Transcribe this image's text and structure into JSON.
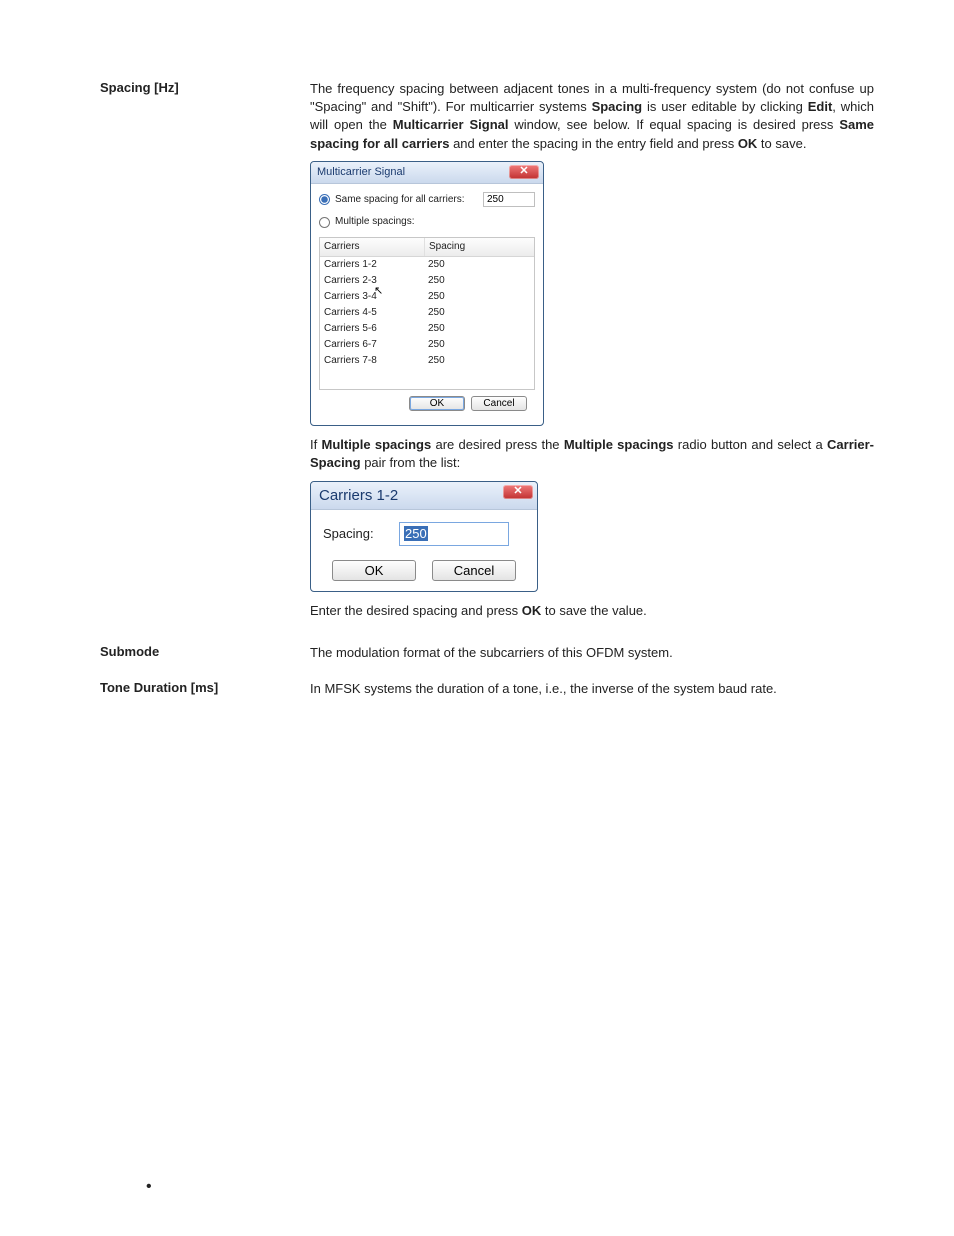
{
  "section1": {
    "label": "Spacing [Hz]",
    "para1_a": "The frequency spacing between adjacent tones in a multi-frequency system (do not confuse up \"Spacing\" and \"Shift\"). For multicarrier systems ",
    "para1_b_bold": "Spacing",
    "para1_c": " is user editable by clicking ",
    "para1_d_bold": "Edit",
    "para1_e": ", which will open the ",
    "para1_f_bold": "Multicarrier Signal",
    "para1_g": " window, see below. If equal spacing is desired press ",
    "para1_h_bold": "Same spacing for all carriers",
    "para1_i": " and enter the spacing in the entry field and press ",
    "para1_j_bold": "OK",
    "para1_k": " to save.",
    "para2_a": "If ",
    "para2_b_bold": "Multiple spacings",
    "para2_c": " are desired press the ",
    "para2_d_bold": "Multiple spacings",
    "para2_e": " radio button and select a ",
    "para2_f_bold": "Carrier-Spacing",
    "para2_g": " pair from the list:",
    "para3_a": "Enter the desired spacing and press ",
    "para3_b_bold": "OK",
    "para3_c": " to save the value."
  },
  "dialog1": {
    "title": "Multicarrier Signal",
    "radio_same": "Same spacing for all carriers:",
    "same_value": "250",
    "radio_multiple": "Multiple spacings:",
    "col1": "Carriers",
    "col2": "Spacing",
    "rows": [
      {
        "c": "Carriers 1-2",
        "s": "250"
      },
      {
        "c": "Carriers 2-3",
        "s": "250"
      },
      {
        "c": "Carriers 3-4",
        "s": "250"
      },
      {
        "c": "Carriers 4-5",
        "s": "250"
      },
      {
        "c": "Carriers 5-6",
        "s": "250"
      },
      {
        "c": "Carriers 6-7",
        "s": "250"
      },
      {
        "c": "Carriers 7-8",
        "s": "250"
      }
    ],
    "ok": "OK",
    "cancel": "Cancel"
  },
  "dialog2": {
    "title": "Carriers 1-2",
    "label": "Spacing:",
    "value": "250",
    "ok": "OK",
    "cancel": "Cancel"
  },
  "section2": {
    "label": "Submode",
    "text": "The modulation format of the subcarriers of this OFDM system."
  },
  "section3": {
    "label": "Tone Duration [ms]",
    "text": "In MFSK systems the duration of a tone, i.e., the inverse of the system baud rate."
  }
}
